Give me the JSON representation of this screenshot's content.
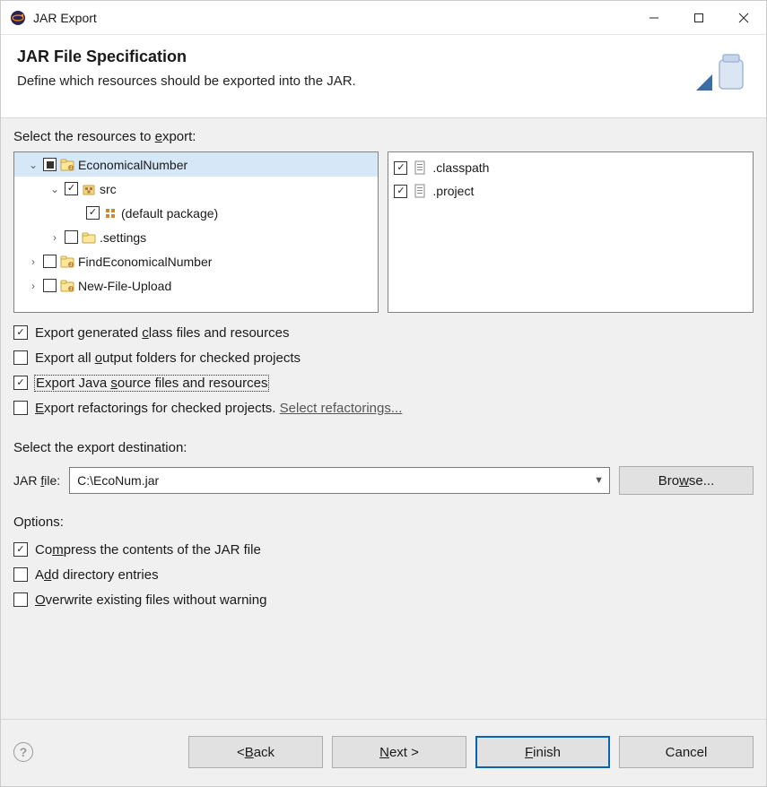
{
  "window": {
    "title": "JAR Export"
  },
  "header": {
    "title": "JAR File Specification",
    "subtitle": "Define which resources should be exported into the JAR."
  },
  "resources": {
    "label_pre": "Select the resources to ",
    "label_u": "e",
    "label_post": "xport:",
    "tree": [
      {
        "level": 0,
        "caret": "v",
        "check": "square",
        "icon": "project",
        "label": "EconomicalNumber",
        "selected": true
      },
      {
        "level": 1,
        "caret": "v",
        "check": "checked",
        "icon": "package-root",
        "label": "src"
      },
      {
        "level": 2,
        "caret": "",
        "check": "checked",
        "icon": "package",
        "label": "(default package)"
      },
      {
        "level": 1,
        "caret": ">",
        "check": "empty",
        "icon": "folder",
        "label": ".settings"
      },
      {
        "level": 0,
        "caret": ">",
        "check": "empty",
        "icon": "project",
        "label": "FindEconomicalNumber"
      },
      {
        "level": 0,
        "caret": ">",
        "check": "empty",
        "icon": "project",
        "label": "New-File-Upload"
      }
    ],
    "files": [
      {
        "check": "checked",
        "label": ".classpath"
      },
      {
        "check": "checked",
        "label": ".project"
      }
    ]
  },
  "exportOptions": [
    {
      "checked": true,
      "pre": "Export generated ",
      "u": "c",
      "post": "lass files and resources"
    },
    {
      "checked": false,
      "pre": "Export all ",
      "u": "o",
      "post": "utput folders for checked projects"
    },
    {
      "checked": true,
      "pre": "Export Java ",
      "u": "s",
      "post": "ource files and resources",
      "focused": true
    },
    {
      "checked": false,
      "pre": "",
      "u": "E",
      "post": "xport refactorings for checked projects. ",
      "link": "Select refactorings..."
    }
  ],
  "destination": {
    "label": "Select the export destination:",
    "field_pre": "JAR ",
    "field_u": "f",
    "field_post": "ile:",
    "value": "C:\\EcoNum.jar",
    "browse_pre": "Bro",
    "browse_u": "w",
    "browse_post": "se..."
  },
  "options": {
    "label": "Options:",
    "items": [
      {
        "checked": true,
        "pre": "Co",
        "u": "m",
        "post": "press the contents of the JAR file"
      },
      {
        "checked": false,
        "pre": "A",
        "u": "d",
        "post": "d directory entries"
      },
      {
        "checked": false,
        "pre": "",
        "u": "O",
        "post": "verwrite existing files without warning"
      }
    ]
  },
  "footer": {
    "back_pre": "< ",
    "back_u": "B",
    "back_post": "ack",
    "next_pre": "",
    "next_u": "N",
    "next_post": "ext >",
    "finish_pre": "",
    "finish_u": "F",
    "finish_post": "inish",
    "cancel": "Cancel"
  }
}
